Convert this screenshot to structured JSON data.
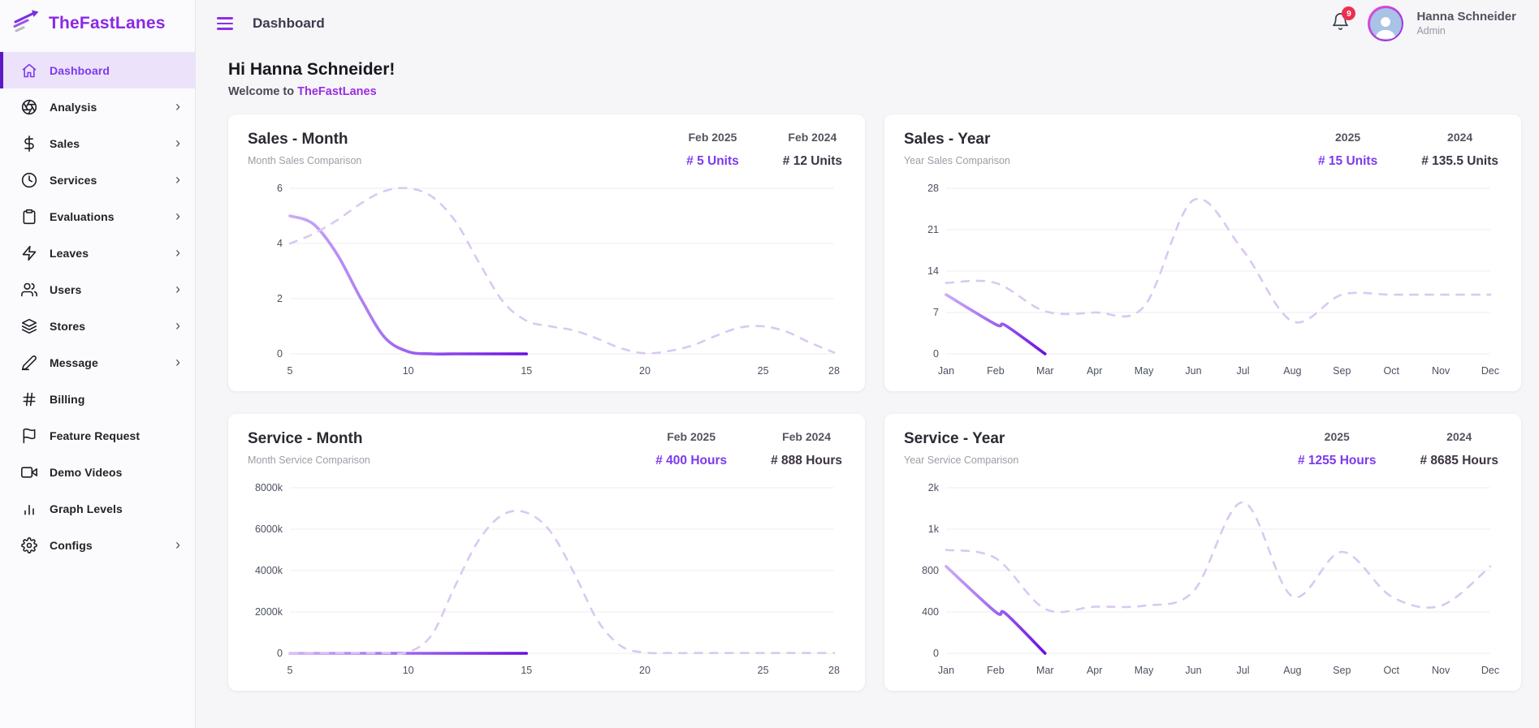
{
  "brand": {
    "name": "TheFastLanes"
  },
  "header": {
    "title": "Dashboard",
    "notification_count": "9",
    "user": {
      "name": "Hanna Schneider",
      "role": "Admin"
    }
  },
  "sidebar": {
    "items": [
      {
        "label": "Dashboard",
        "icon": "home-icon",
        "active": true,
        "has_chevron": false
      },
      {
        "label": "Analysis",
        "icon": "aperture-icon",
        "active": false,
        "has_chevron": true
      },
      {
        "label": "Sales",
        "icon": "dollar-icon",
        "active": false,
        "has_chevron": true
      },
      {
        "label": "Services",
        "icon": "clock-icon",
        "active": false,
        "has_chevron": true
      },
      {
        "label": "Evaluations",
        "icon": "clipboard-icon",
        "active": false,
        "has_chevron": true
      },
      {
        "label": "Leaves",
        "icon": "zap-icon",
        "active": false,
        "has_chevron": true
      },
      {
        "label": "Users",
        "icon": "users-icon",
        "active": false,
        "has_chevron": true
      },
      {
        "label": "Stores",
        "icon": "layers-icon",
        "active": false,
        "has_chevron": true
      },
      {
        "label": "Message",
        "icon": "edit-icon",
        "active": false,
        "has_chevron": true
      },
      {
        "label": "Billing",
        "icon": "hash-icon",
        "active": false,
        "has_chevron": false
      },
      {
        "label": "Feature Request",
        "icon": "flag-icon",
        "active": false,
        "has_chevron": false
      },
      {
        "label": "Demo Videos",
        "icon": "video-icon",
        "active": false,
        "has_chevron": false
      },
      {
        "label": "Graph Levels",
        "icon": "bar-chart-icon",
        "active": false,
        "has_chevron": false
      },
      {
        "label": "Configs",
        "icon": "gear-icon",
        "active": false,
        "has_chevron": true
      }
    ]
  },
  "main": {
    "greeting": "Hi Hanna Schneider!",
    "welcome_prefix": "Welcome to ",
    "welcome_brand": "TheFastLanes"
  },
  "colors": {
    "accent": "#7c3aed",
    "accent_deep": "#5d18c4",
    "dashed_line": "#dac8f3",
    "solid_gradient": [
      "#cbadf6",
      "#9a5cf0",
      "#6a0fe0"
    ],
    "grid": "#ececf2",
    "axis_text": "#4b5160",
    "badge_red": "#ee2d4f"
  },
  "chart_data": [
    {
      "id": "sales_month",
      "type": "line",
      "title": "Sales - Month",
      "subtitle": "Month Sales Comparison",
      "stats": [
        {
          "label": "Feb 2025",
          "value": "# 5 Units"
        },
        {
          "label": "Feb 2024",
          "value": "# 12 Units"
        }
      ],
      "legend_position": "none",
      "grid": true,
      "xdomain": [
        5,
        28
      ],
      "x_ticks": [
        {
          "v": 5,
          "label": "5"
        },
        {
          "v": 10,
          "label": "10"
        },
        {
          "v": 15,
          "label": "15"
        },
        {
          "v": 20,
          "label": "20"
        },
        {
          "v": 25,
          "label": "25"
        },
        {
          "v": 28,
          "label": "28"
        }
      ],
      "y_ticks": [
        {
          "v": 0,
          "label": "0"
        },
        {
          "v": 2,
          "label": "2"
        },
        {
          "v": 4,
          "label": "4"
        },
        {
          "v": 6,
          "label": "6"
        }
      ],
      "series": [
        {
          "name": "2025",
          "style": "solid",
          "x": [
            5,
            6,
            7,
            8,
            9,
            10,
            11,
            12,
            13,
            14,
            15
          ],
          "y": [
            5,
            4.7,
            3.6,
            2,
            0.6,
            0.08,
            0,
            0,
            0,
            0,
            0
          ]
        },
        {
          "name": "2024",
          "style": "dashed",
          "x": [
            5,
            6,
            7,
            8,
            9,
            10,
            11,
            12,
            13,
            14,
            15,
            16,
            17,
            18,
            19,
            20,
            21,
            22,
            23,
            24,
            25,
            26,
            27,
            28
          ],
          "y": [
            4,
            4.35,
            4.85,
            5.45,
            5.9,
            6,
            5.7,
            4.8,
            3.3,
            1.9,
            1.2,
            1,
            0.85,
            0.55,
            0.2,
            0.02,
            0.1,
            0.3,
            0.65,
            0.95,
            1,
            0.8,
            0.4,
            0.05
          ]
        }
      ]
    },
    {
      "id": "sales_year",
      "type": "line",
      "title": "Sales - Year",
      "subtitle": "Year Sales Comparison",
      "stats": [
        {
          "label": "2025",
          "value": "# 15 Units"
        },
        {
          "label": "2024",
          "value": "# 135.5 Units"
        }
      ],
      "legend_position": "none",
      "grid": true,
      "xdomain": [
        0,
        11
      ],
      "x_ticks": [
        {
          "v": 0,
          "label": "Jan"
        },
        {
          "v": 1,
          "label": "Feb"
        },
        {
          "v": 2,
          "label": "Mar"
        },
        {
          "v": 3,
          "label": "Apr"
        },
        {
          "v": 4,
          "label": "May"
        },
        {
          "v": 5,
          "label": "Jun"
        },
        {
          "v": 6,
          "label": "Jul"
        },
        {
          "v": 7,
          "label": "Aug"
        },
        {
          "v": 8,
          "label": "Sep"
        },
        {
          "v": 9,
          "label": "Oct"
        },
        {
          "v": 10,
          "label": "Nov"
        },
        {
          "v": 11,
          "label": "Dec"
        }
      ],
      "y_ticks": [
        {
          "v": 0,
          "label": "0"
        },
        {
          "v": 7,
          "label": "7"
        },
        {
          "v": 14,
          "label": "14"
        },
        {
          "v": 21,
          "label": "21"
        },
        {
          "v": 28,
          "label": "28"
        }
      ],
      "series": [
        {
          "name": "2025",
          "style": "solid",
          "x": [
            0,
            1,
            1.2,
            2
          ],
          "y": [
            10,
            5,
            4.8,
            0
          ]
        },
        {
          "name": "2024",
          "style": "dashed",
          "x": [
            0,
            1,
            2,
            3,
            4,
            5,
            6,
            7,
            8,
            9,
            10,
            11
          ],
          "y": [
            12,
            12,
            7.2,
            7,
            8,
            26,
            17.5,
            5.5,
            10,
            10,
            10,
            10
          ]
        }
      ]
    },
    {
      "id": "service_month",
      "type": "line",
      "title": "Service - Month",
      "subtitle": "Month Service Comparison",
      "stats": [
        {
          "label": "Feb 2025",
          "value": "# 400 Hours"
        },
        {
          "label": "Feb 2024",
          "value": "# 888 Hours"
        }
      ],
      "legend_position": "none",
      "grid": true,
      "xdomain": [
        5,
        28
      ],
      "x_ticks": [
        {
          "v": 5,
          "label": "5"
        },
        {
          "v": 10,
          "label": "10"
        },
        {
          "v": 15,
          "label": "15"
        },
        {
          "v": 20,
          "label": "20"
        },
        {
          "v": 25,
          "label": "25"
        },
        {
          "v": 28,
          "label": "28"
        }
      ],
      "y_ticks": [
        {
          "v": 0,
          "label": "0"
        },
        {
          "v": 2000,
          "label": "2000k"
        },
        {
          "v": 4000,
          "label": "4000k"
        },
        {
          "v": 6000,
          "label": "6000k"
        },
        {
          "v": 8000,
          "label": "8000k"
        }
      ],
      "series": [
        {
          "name": "2025",
          "style": "solid",
          "x": [
            5,
            10,
            15
          ],
          "y": [
            0,
            0,
            0
          ]
        },
        {
          "name": "2024",
          "style": "dashed",
          "x": [
            5,
            6,
            7,
            8,
            9,
            10,
            11,
            12,
            13,
            14,
            15,
            16,
            17,
            18,
            19,
            20,
            21,
            22,
            23,
            24,
            25,
            26,
            27,
            28
          ],
          "y": [
            20,
            20,
            20,
            20,
            20,
            60,
            900,
            3300,
            5500,
            6700,
            6800,
            5900,
            3900,
            1600,
            350,
            40,
            15,
            15,
            15,
            15,
            15,
            15,
            15,
            15
          ]
        }
      ]
    },
    {
      "id": "service_year",
      "type": "line",
      "title": "Service - Year",
      "subtitle": "Year Service Comparison",
      "stats": [
        {
          "label": "2025",
          "value": "# 1255 Hours"
        },
        {
          "label": "2024",
          "value": "# 8685 Hours"
        }
      ],
      "legend_position": "none",
      "grid": true,
      "xdomain": [
        0,
        11
      ],
      "x_ticks": [
        {
          "v": 0,
          "label": "Jan"
        },
        {
          "v": 1,
          "label": "Feb"
        },
        {
          "v": 2,
          "label": "Mar"
        },
        {
          "v": 3,
          "label": "Apr"
        },
        {
          "v": 4,
          "label": "May"
        },
        {
          "v": 5,
          "label": "Jun"
        },
        {
          "v": 6,
          "label": "Jul"
        },
        {
          "v": 7,
          "label": "Aug"
        },
        {
          "v": 8,
          "label": "Sep"
        },
        {
          "v": 9,
          "label": "Oct"
        },
        {
          "v": 10,
          "label": "Nov"
        },
        {
          "v": 11,
          "label": "Dec"
        }
      ],
      "y_ticks": [
        {
          "v": 0,
          "label": "0"
        },
        {
          "v": 400,
          "label": "400"
        },
        {
          "v": 800,
          "label": "800"
        },
        {
          "v": 1000,
          "label": "1k"
        },
        {
          "v": 2000,
          "label": "2k"
        }
      ],
      "series": [
        {
          "name": "2025",
          "style": "solid",
          "x": [
            0,
            1,
            1.2,
            2
          ],
          "y": [
            820,
            400,
            385,
            0
          ]
        },
        {
          "name": "2024",
          "style": "dashed",
          "x": [
            0,
            1,
            2,
            3,
            4,
            5,
            6,
            7,
            8,
            9,
            10,
            11
          ],
          "y": [
            900,
            860,
            430,
            450,
            460,
            600,
            1650,
            550,
            890,
            550,
            460,
            820
          ]
        }
      ]
    }
  ]
}
